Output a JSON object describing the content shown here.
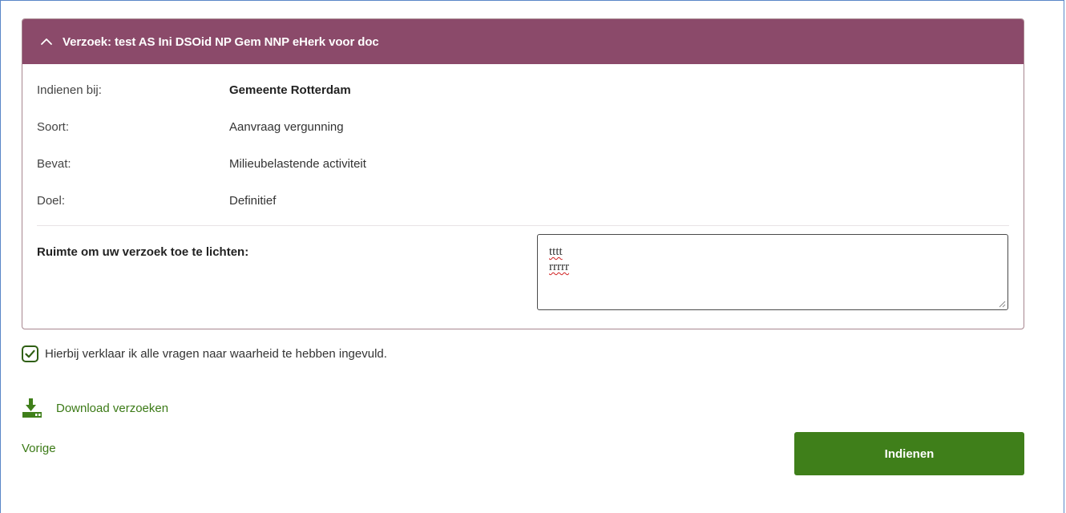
{
  "request": {
    "header_title": "Verzoek: test AS Ini DSOid NP Gem NNP eHerk voor doc",
    "details": [
      {
        "label": "Indienen bij:",
        "value": "Gemeente Rotterdam",
        "bold": true
      },
      {
        "label": "Soort:",
        "value": "Aanvraag vergunning"
      },
      {
        "label": "Bevat:",
        "value": "Milieubelastende activiteit"
      },
      {
        "label": "Doel:",
        "value": "Definitief"
      }
    ],
    "explain_label": "Ruimte om uw verzoek toe te lichten:",
    "explain_lines": [
      "tttt",
      "rrrrr"
    ]
  },
  "declaration": {
    "checked": true,
    "text": "Hierbij verklaar ik alle vragen naar waarheid te hebben ingevuld."
  },
  "actions": {
    "download_label": "Download verzoeken",
    "back_label": "Vorige",
    "submit_label": "Indienen"
  },
  "colors": {
    "header_bg": "#8b4a6a",
    "accent_green": "#3f7f1a",
    "link_green": "#3b7a16"
  },
  "icons": {
    "collapse": "chevron-up-icon",
    "checkbox": "checkbox-checked-icon",
    "download": "download-icon"
  }
}
